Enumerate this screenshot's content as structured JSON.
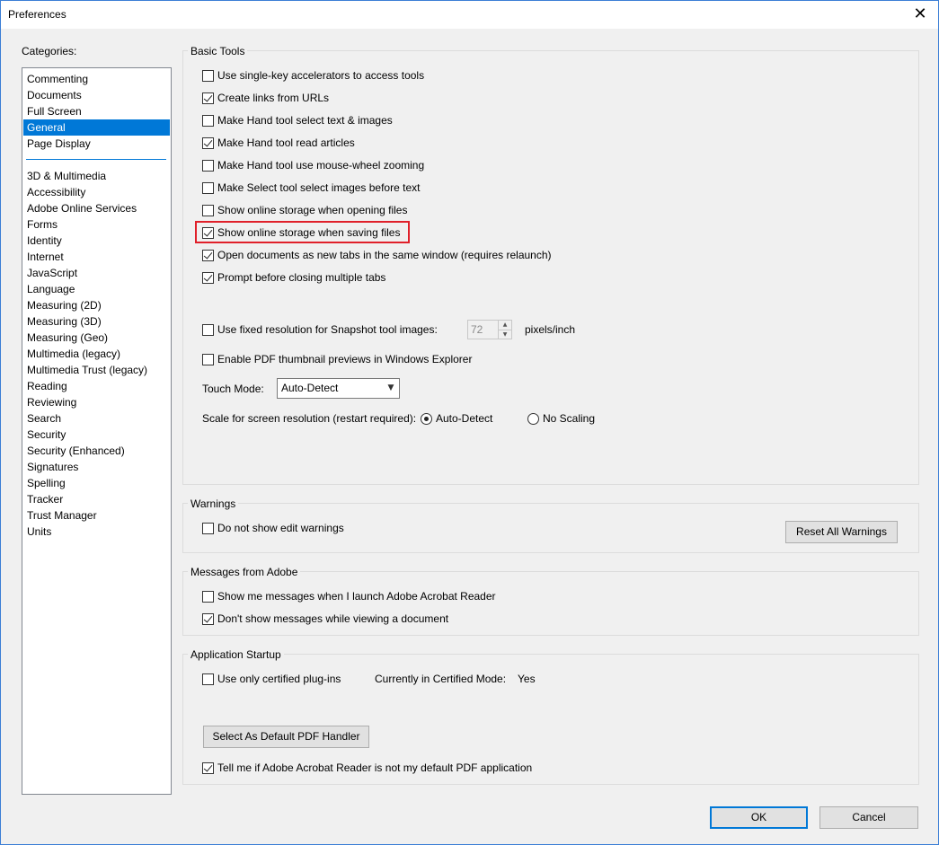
{
  "window": {
    "title": "Preferences",
    "close_glyph": "✕"
  },
  "categories": {
    "label": "Categories:",
    "group1": [
      "Commenting",
      "Documents",
      "Full Screen",
      "General",
      "Page Display"
    ],
    "group2": [
      "3D & Multimedia",
      "Accessibility",
      "Adobe Online Services",
      "Forms",
      "Identity",
      "Internet",
      "JavaScript",
      "Language",
      "Measuring (2D)",
      "Measuring (3D)",
      "Measuring (Geo)",
      "Multimedia (legacy)",
      "Multimedia Trust (legacy)",
      "Reading",
      "Reviewing",
      "Search",
      "Security",
      "Security (Enhanced)",
      "Signatures",
      "Spelling",
      "Tracker",
      "Trust Manager",
      "Units"
    ],
    "selected": "General"
  },
  "basic_tools": {
    "title": "Basic Tools",
    "checkboxes": [
      {
        "label": "Use single-key accelerators to access tools",
        "checked": false
      },
      {
        "label": "Create links from URLs",
        "checked": true
      },
      {
        "label": "Make Hand tool select text & images",
        "checked": false
      },
      {
        "label": "Make Hand tool read articles",
        "checked": true
      },
      {
        "label": "Make Hand tool use mouse-wheel zooming",
        "checked": false
      },
      {
        "label": "Make Select tool select images before text",
        "checked": false
      },
      {
        "label": "Show online storage when opening files",
        "checked": false
      },
      {
        "label": "Show online storage when saving files",
        "checked": true
      },
      {
        "label": "Open documents as new tabs in the same window (requires relaunch)",
        "checked": true
      },
      {
        "label": "Prompt before closing multiple tabs",
        "checked": true
      }
    ],
    "snapshot": {
      "label": "Use fixed resolution for Snapshot tool images:",
      "checked": false,
      "value": "72",
      "units": "pixels/inch"
    },
    "thumbnail": {
      "label": "Enable PDF thumbnail previews in Windows Explorer",
      "checked": false
    },
    "touch_mode": {
      "label": "Touch Mode:",
      "value": "Auto-Detect"
    },
    "scale": {
      "label": "Scale for screen resolution (restart required):",
      "options": [
        {
          "label": "Auto-Detect",
          "selected": true
        },
        {
          "label": "No Scaling",
          "selected": false
        }
      ]
    }
  },
  "warnings": {
    "title": "Warnings",
    "checkbox": {
      "label": "Do not show edit warnings",
      "checked": false
    },
    "reset_button": "Reset All Warnings"
  },
  "messages": {
    "title": "Messages from Adobe",
    "checkboxes": [
      {
        "label": "Show me messages when I launch Adobe Acrobat Reader",
        "checked": false
      },
      {
        "label": "Don't show messages while viewing a document",
        "checked": true
      }
    ]
  },
  "startup": {
    "title": "Application Startup",
    "certified": {
      "label": "Use only certified plug-ins",
      "checked": false
    },
    "mode_label": "Currently in Certified Mode:",
    "mode_value": "Yes",
    "default_handler_button": "Select As Default PDF Handler",
    "tell_me": {
      "label": "Tell me if Adobe Acrobat Reader is not my default PDF application",
      "checked": true
    }
  },
  "footer": {
    "ok": "OK",
    "cancel": "Cancel"
  },
  "colors": {
    "accent": "#0078d7",
    "highlight_box": "#e0202a",
    "window_border": "#3c7fd6"
  }
}
